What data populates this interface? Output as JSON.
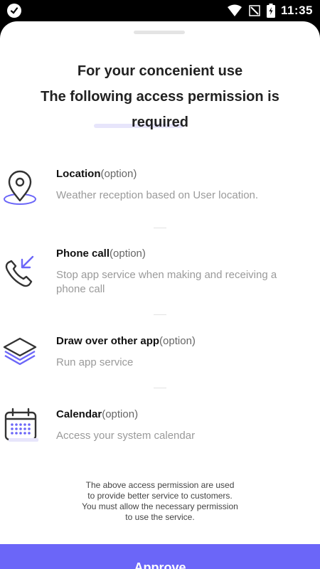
{
  "status_bar": {
    "time": "11:35",
    "icons": [
      "app-check-icon",
      "wifi-icon",
      "no-signal-icon",
      "battery-charging-icon"
    ]
  },
  "dialog": {
    "title_lines": [
      "For your concenient use",
      "The following access permission is",
      "required"
    ],
    "permissions": [
      {
        "icon": "location-pin-icon",
        "name": "Location",
        "option": "(option)",
        "description": "Weather reception based on User location."
      },
      {
        "icon": "phone-call-icon",
        "name": "Phone call",
        "option": "(option)",
        "description": "Stop app service when making and receiving a phone call"
      },
      {
        "icon": "layers-icon",
        "name": "Draw over other app",
        "option": "(option)",
        "description": "Run app service"
      },
      {
        "icon": "calendar-icon",
        "name": "Calendar",
        "option": "(option)",
        "description": "Access your system calendar"
      }
    ],
    "footer_lines": [
      "The above access permission are used",
      "to provide better service to customers.",
      "You must allow the necessary permission",
      "to use the service."
    ],
    "approve_label": "Approve"
  },
  "colors": {
    "accent": "#6b66f8",
    "icon_purple": "#6b66f8",
    "icon_dark": "#333333",
    "highlight": "#e7e5fb"
  }
}
